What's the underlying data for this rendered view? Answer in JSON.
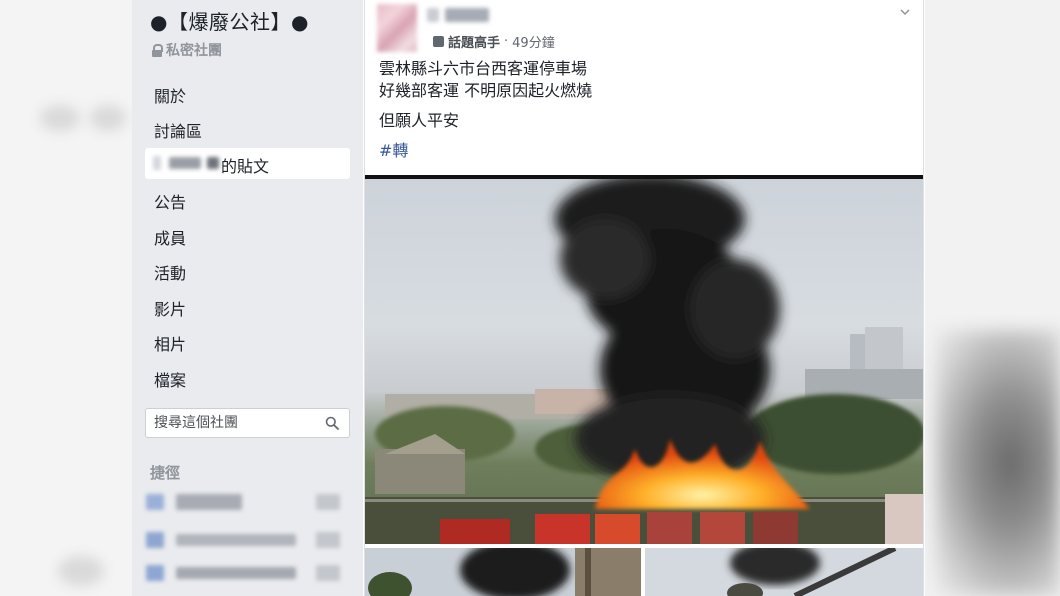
{
  "group": {
    "title": "●【爆廢公社】●",
    "privacy": "私密社團"
  },
  "nav": {
    "items": [
      "關於",
      "討論區",
      "公告",
      "成員",
      "活動",
      "影片",
      "相片",
      "檔案"
    ],
    "active_suffix": "的貼文"
  },
  "search": {
    "placeholder": "搜尋這個社團"
  },
  "shortcuts": {
    "title": "捷徑"
  },
  "post": {
    "badge": "話題高手",
    "separator": "·",
    "time": "49分鐘",
    "lines": [
      "雲林縣斗六市台西客運停車場",
      "好幾部客運 不明原因起火燃燒"
    ],
    "line3": "但願人平安",
    "hashtag": "#轉"
  },
  "icons": {
    "lock": "lock-icon",
    "search": "search-icon",
    "chevron": "chevron-down-icon",
    "badge": "coffee-badge-icon"
  },
  "colors": {
    "sidebar_bg": "#e9ebee",
    "link": "#365899",
    "meta": "#616770"
  }
}
